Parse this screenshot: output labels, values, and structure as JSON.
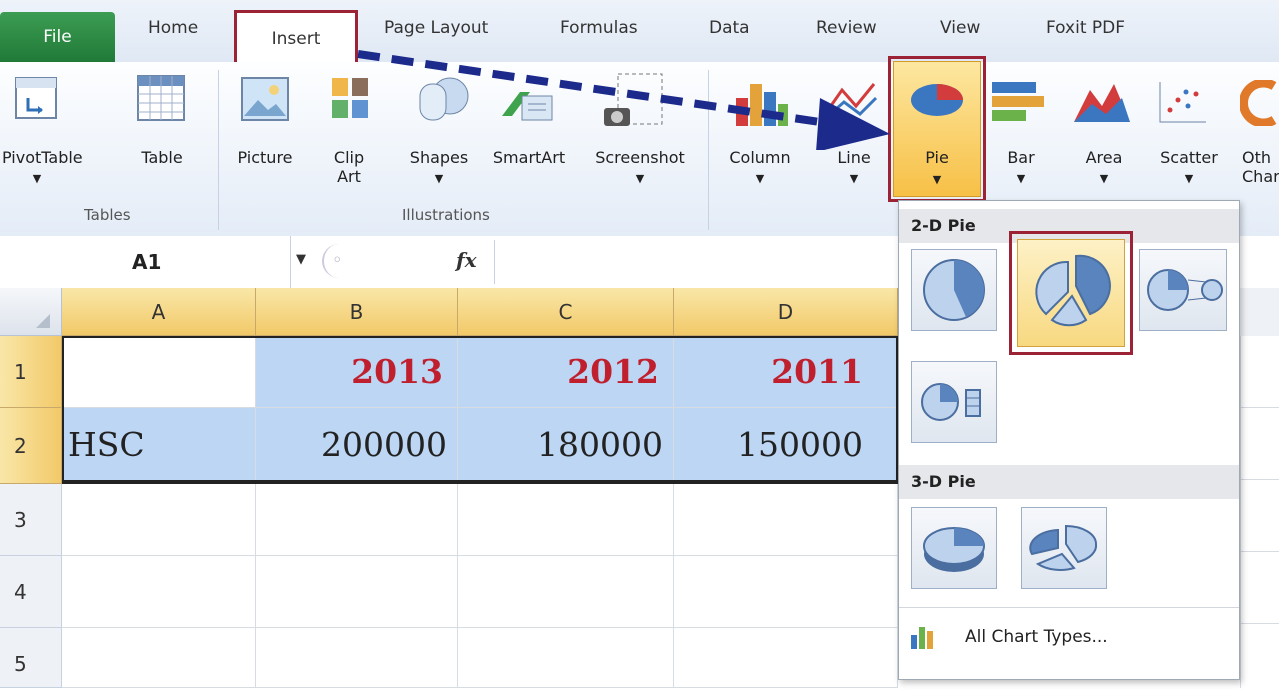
{
  "tabs": [
    "File",
    "Home",
    "Insert",
    "Page Layout",
    "Formulas",
    "Data",
    "Review",
    "View",
    "Foxit PDF"
  ],
  "ribbon": {
    "buttons": {
      "pivottable": "PivotTable",
      "table": "Table",
      "picture": "Picture",
      "clip_art_1": "Clip",
      "clip_art_2": "Art",
      "shapes": "Shapes",
      "smartart": "SmartArt",
      "screenshot": "Screenshot",
      "column": "Column",
      "line": "Line",
      "pie": "Pie",
      "bar": "Bar",
      "area": "Area",
      "scatter": "Scatter",
      "other_1": "Oth",
      "other_2": "Char"
    },
    "groups": {
      "tables": "Tables",
      "illustrations": "Illustrations"
    }
  },
  "formula_bar": {
    "name_box": "A1",
    "fx": "fx",
    "value": ""
  },
  "grid": {
    "columns": [
      "A",
      "B",
      "C",
      "D"
    ],
    "rows": [
      "1",
      "2",
      "3",
      "4",
      "5"
    ],
    "cells": {
      "b1": "2013",
      "c1": "2012",
      "d1": "2011",
      "a2": "HSC",
      "b2": "200000",
      "c2": "180000",
      "d2": "150000"
    }
  },
  "pie_menu": {
    "header_2d": "2-D Pie",
    "header_3d": "3-D Pie",
    "all_chart_types": "All Chart Types..."
  },
  "colors": {
    "highlight_border": "#9b2335",
    "arrow": "#1c2a8c",
    "year_text": "#c0202e",
    "selection": "#bcd6f4"
  }
}
